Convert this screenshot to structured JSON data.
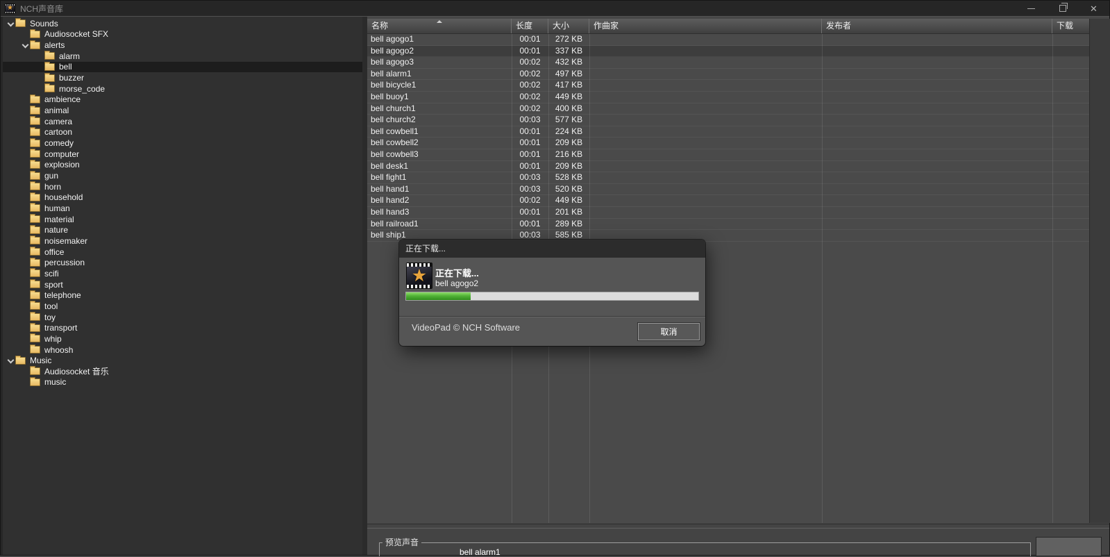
{
  "colors": {
    "progress_green": "#3f9e2a",
    "folder_gold": "#eebc5e",
    "tree_selection": "#1d1d1d",
    "row_selection": "#3d3d3d",
    "dialog_body": "#555555"
  },
  "titlebar": {
    "title": "NCH声音库",
    "app_icon": "videopad-film-star-icon",
    "star_glyph": "★"
  },
  "tree": {
    "items": [
      {
        "label": "Sounds",
        "level": 0,
        "expanded": true
      },
      {
        "label": "Audiosocket SFX",
        "level": 1
      },
      {
        "label": "alerts",
        "level": 1,
        "expanded": true
      },
      {
        "label": "alarm",
        "level": 2
      },
      {
        "label": "bell",
        "level": 2,
        "selected": true
      },
      {
        "label": "buzzer",
        "level": 2
      },
      {
        "label": "morse_code",
        "level": 2
      },
      {
        "label": "ambience",
        "level": 1
      },
      {
        "label": "animal",
        "level": 1
      },
      {
        "label": "camera",
        "level": 1
      },
      {
        "label": "cartoon",
        "level": 1
      },
      {
        "label": "comedy",
        "level": 1
      },
      {
        "label": "computer",
        "level": 1
      },
      {
        "label": "explosion",
        "level": 1
      },
      {
        "label": "gun",
        "level": 1
      },
      {
        "label": "horn",
        "level": 1
      },
      {
        "label": "household",
        "level": 1
      },
      {
        "label": "human",
        "level": 1
      },
      {
        "label": "material",
        "level": 1
      },
      {
        "label": "nature",
        "level": 1
      },
      {
        "label": "noisemaker",
        "level": 1
      },
      {
        "label": "office",
        "level": 1
      },
      {
        "label": "percussion",
        "level": 1
      },
      {
        "label": "scifi",
        "level": 1
      },
      {
        "label": "sport",
        "level": 1
      },
      {
        "label": "telephone",
        "level": 1
      },
      {
        "label": "tool",
        "level": 1
      },
      {
        "label": "toy",
        "level": 1
      },
      {
        "label": "transport",
        "level": 1
      },
      {
        "label": "whip",
        "level": 1
      },
      {
        "label": "whoosh",
        "level": 1
      },
      {
        "label": "Music",
        "level": 0,
        "expanded": true
      },
      {
        "label": "Audiosocket 音乐",
        "level": 1
      },
      {
        "label": "music",
        "level": 1
      }
    ]
  },
  "table": {
    "columns": [
      {
        "label": "名称",
        "sort": "asc"
      },
      {
        "label": "长度"
      },
      {
        "label": "大小"
      },
      {
        "label": "作曲家"
      },
      {
        "label": "发布者"
      },
      {
        "label": "下载"
      }
    ],
    "rows": [
      {
        "name": "bell agogo1",
        "length": "00:01",
        "size": "272 KB",
        "composer": "",
        "publisher": "",
        "download": ""
      },
      {
        "name": "bell agogo2",
        "length": "00:01",
        "size": "337 KB",
        "composer": "",
        "publisher": "",
        "download": "",
        "selected": true
      },
      {
        "name": "bell agogo3",
        "length": "00:02",
        "size": "432 KB",
        "composer": "",
        "publisher": "",
        "download": ""
      },
      {
        "name": "bell alarm1",
        "length": "00:02",
        "size": "497 KB",
        "composer": "",
        "publisher": "",
        "download": ""
      },
      {
        "name": "bell bicycle1",
        "length": "00:02",
        "size": "417 KB",
        "composer": "",
        "publisher": "",
        "download": ""
      },
      {
        "name": "bell buoy1",
        "length": "00:02",
        "size": "449 KB",
        "composer": "",
        "publisher": "",
        "download": ""
      },
      {
        "name": "bell church1",
        "length": "00:02",
        "size": "400 KB",
        "composer": "",
        "publisher": "",
        "download": ""
      },
      {
        "name": "bell church2",
        "length": "00:03",
        "size": "577 KB",
        "composer": "",
        "publisher": "",
        "download": ""
      },
      {
        "name": "bell cowbell1",
        "length": "00:01",
        "size": "224 KB",
        "composer": "",
        "publisher": "",
        "download": ""
      },
      {
        "name": "bell cowbell2",
        "length": "00:01",
        "size": "209 KB",
        "composer": "",
        "publisher": "",
        "download": ""
      },
      {
        "name": "bell cowbell3",
        "length": "00:01",
        "size": "216 KB",
        "composer": "",
        "publisher": "",
        "download": ""
      },
      {
        "name": "bell desk1",
        "length": "00:01",
        "size": "209 KB",
        "composer": "",
        "publisher": "",
        "download": ""
      },
      {
        "name": "bell fight1",
        "length": "00:03",
        "size": "528 KB",
        "composer": "",
        "publisher": "",
        "download": ""
      },
      {
        "name": "bell hand1",
        "length": "00:03",
        "size": "520 KB",
        "composer": "",
        "publisher": "",
        "download": ""
      },
      {
        "name": "bell hand2",
        "length": "00:02",
        "size": "449 KB",
        "composer": "",
        "publisher": "",
        "download": ""
      },
      {
        "name": "bell hand3",
        "length": "00:01",
        "size": "201 KB",
        "composer": "",
        "publisher": "",
        "download": ""
      },
      {
        "name": "bell railroad1",
        "length": "00:01",
        "size": "289 KB",
        "composer": "",
        "publisher": "",
        "download": ""
      },
      {
        "name": "bell ship1",
        "length": "00:03",
        "size": "585 KB",
        "composer": "",
        "publisher": "",
        "download": ""
      }
    ]
  },
  "dialog": {
    "title": "正在下载...",
    "heading": "正在下载...",
    "file_name": "bell agogo2",
    "progress_percent": 22,
    "footer": "VideoPad © NCH Software",
    "cancel_label": "取消",
    "icon_star_glyph": "★"
  },
  "preview": {
    "label": "预览声音",
    "now_playing": "bell alarm1"
  }
}
